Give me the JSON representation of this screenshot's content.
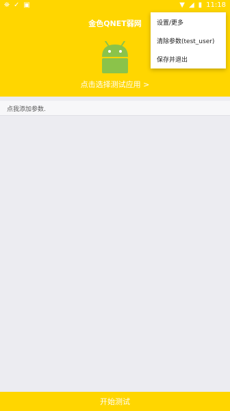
{
  "statusbar": {
    "left_icons": [
      "notification-icon-1",
      "notification-icon-2",
      "notification-icon-3"
    ],
    "right_icons": [
      "wifi-icon",
      "signal-icon",
      "battery-icon"
    ],
    "time": "11:18"
  },
  "header": {
    "title": "金色QNET弱网",
    "choose_app": "点击选择测试应用 >"
  },
  "params": {
    "placeholder": "点我添加参数."
  },
  "menu": {
    "items": [
      {
        "label": "设置/更多"
      },
      {
        "label": "清除参数(test_user)"
      },
      {
        "label": "保存并退出"
      }
    ]
  },
  "footer": {
    "start_label": "开始测试"
  },
  "colors": {
    "accent": "#ffd600",
    "background": "#ececf1",
    "android_green": "#8bc34a"
  }
}
